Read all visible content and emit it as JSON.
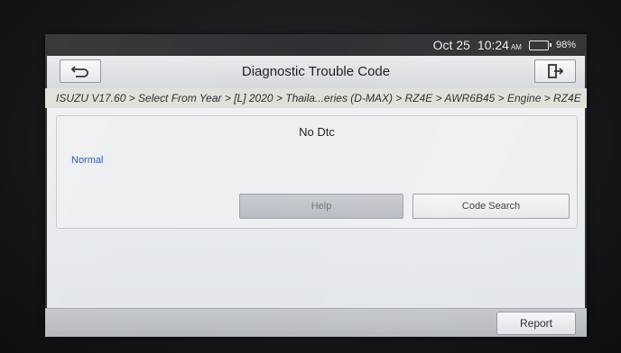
{
  "status_bar": {
    "date": "Oct 25",
    "time": "10:24",
    "ampm": "AM",
    "battery": "98%"
  },
  "header": {
    "title": "Diagnostic Trouble Code",
    "back_icon": "back-arrow-icon",
    "exit_icon": "exit-door-icon"
  },
  "breadcrumb": "ISUZU V17.60 > Select From Year > [L] 2020 > Thaila...eries (D-MAX) > RZ4E > AWR6B45 > Engine > RZ4E",
  "dtc": {
    "title": "No Dtc",
    "status": "Normal"
  },
  "buttons": {
    "help": "Help",
    "code_search": "Code Search",
    "report": "Report"
  },
  "colors": {
    "status_text": "#2a55b8",
    "titlebar": "#dfe2e6",
    "breadcrumb_bg": "#dfe1d9"
  }
}
